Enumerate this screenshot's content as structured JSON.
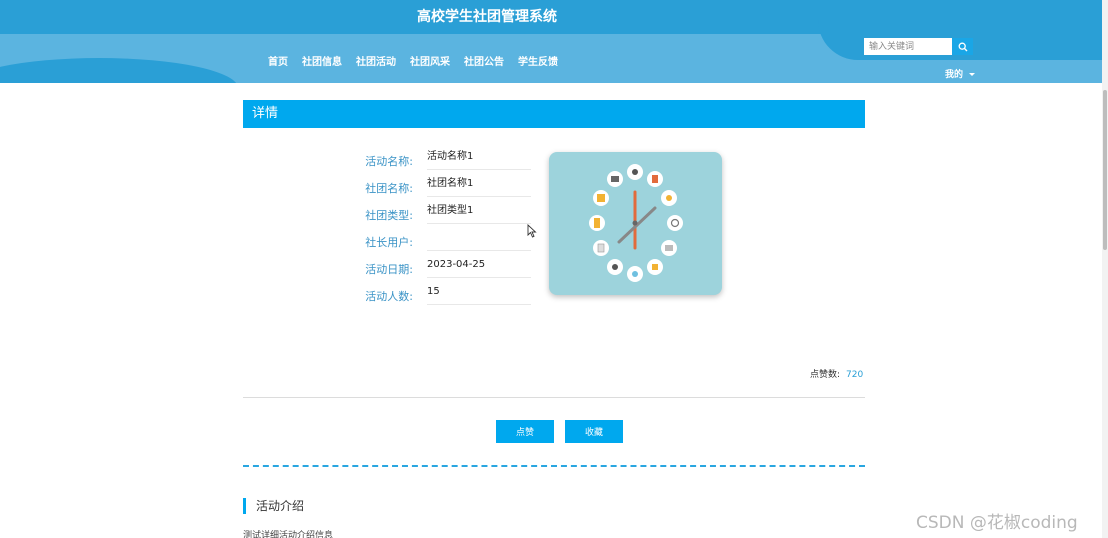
{
  "header": {
    "site_title": "高校学生社团管理系统",
    "nav": [
      "首页",
      "社团信息",
      "社团活动",
      "社团风采",
      "社团公告",
      "学生反馈"
    ],
    "search": {
      "placeholder": "输入关键词",
      "value": "",
      "icon": "search-icon"
    },
    "user_menu": {
      "label": "我的",
      "icon": "caret-down-icon"
    }
  },
  "detail": {
    "panel_title": "详情",
    "fields": [
      {
        "label": "活动名称:",
        "value": "活动名称1"
      },
      {
        "label": "社团名称:",
        "value": "社团名称1"
      },
      {
        "label": "社团类型:",
        "value": "社团类型1"
      },
      {
        "label": "社长用户:",
        "value": ""
      },
      {
        "label": "活动日期:",
        "value": "2023-04-25"
      },
      {
        "label": "活动人数:",
        "value": "15"
      }
    ],
    "likes": {
      "label": "点赞数:",
      "value": "720"
    },
    "buttons": {
      "like": "点赞",
      "favorite": "收藏"
    }
  },
  "intro": {
    "title": "活动介绍",
    "body": "测试详细活动介绍信息"
  },
  "watermark": "CSDN @花椒coding",
  "colors": {
    "header": "#2a9fd6",
    "band": "#5bb4e0",
    "accent": "#00a8ee",
    "label": "#3a93c6",
    "image_bg": "#9dd3dc"
  }
}
